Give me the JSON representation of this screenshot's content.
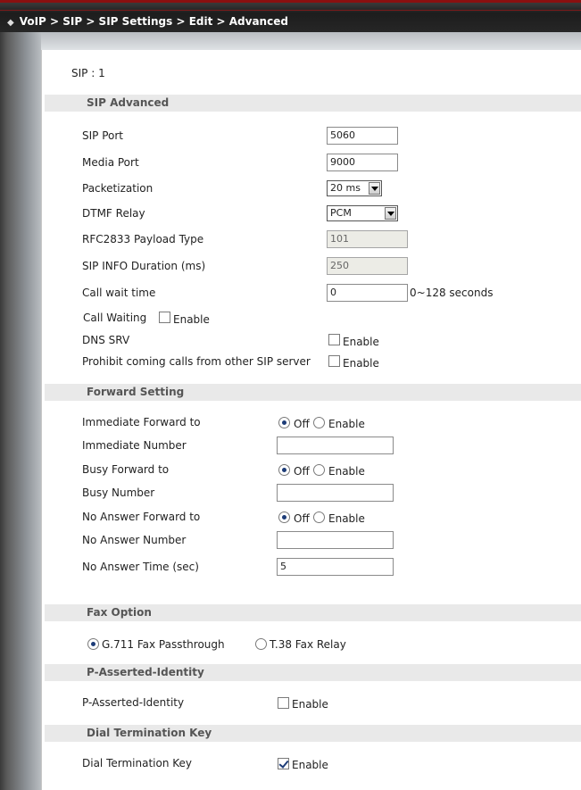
{
  "breadcrumb": "VoIP > SIP > SIP Settings > Edit > Advanced",
  "sip_id": "SIP : 1",
  "sections": {
    "sip_advanced": "SIP Advanced",
    "forward": "Forward Setting",
    "fax": "Fax Option",
    "pai": "P-Asserted-Identity",
    "dtk": "Dial Termination Key"
  },
  "sip_advanced": {
    "sip_port": {
      "label": "SIP Port",
      "value": "5060"
    },
    "media_port": {
      "label": "Media Port",
      "value": "9000"
    },
    "packetization": {
      "label": "Packetization",
      "value": "20 ms"
    },
    "dtmf_relay": {
      "label": "DTMF Relay",
      "value": "PCM"
    },
    "rfc2833": {
      "label": "RFC2833 Payload Type",
      "value": "101"
    },
    "sip_info": {
      "label": "SIP INFO Duration (ms)",
      "value": "250"
    },
    "call_wait_time": {
      "label": "Call wait time",
      "value": "0",
      "suffix": "0~128 seconds"
    },
    "call_waiting": {
      "label": "Call Waiting",
      "option": "Enable",
      "checked": false
    },
    "dns_srv": {
      "label": "DNS SRV",
      "option": "Enable",
      "checked": false
    },
    "prohibit": {
      "label": "Prohibit coming calls from other SIP server",
      "option": "Enable",
      "checked": false
    }
  },
  "forward": {
    "immediate": {
      "label": "Immediate Forward to",
      "off": "Off",
      "enable": "Enable",
      "selected": "Off"
    },
    "immediate_number": {
      "label": "Immediate Number",
      "value": ""
    },
    "busy": {
      "label": "Busy Forward to",
      "off": "Off",
      "enable": "Enable",
      "selected": "Off"
    },
    "busy_number": {
      "label": "Busy Number",
      "value": ""
    },
    "no_answer": {
      "label": "No Answer Forward to",
      "off": "Off",
      "enable": "Enable",
      "selected": "Off"
    },
    "no_answer_number": {
      "label": "No Answer Number",
      "value": ""
    },
    "no_answer_time": {
      "label": "No Answer Time (sec)",
      "value": "5"
    }
  },
  "fax": {
    "g711": "G.711 Fax Passthrough",
    "t38": "T.38 Fax Relay",
    "selected": "G.711 Fax Passthrough"
  },
  "pai": {
    "label": "P-Asserted-Identity",
    "option": "Enable",
    "checked": false
  },
  "dtk": {
    "label": "Dial Termination Key",
    "option": "Enable",
    "checked": true
  },
  "colors": {
    "accent": "#1d3c78",
    "section_bg": "#e9e9e9",
    "topbar_red": "#8a1010"
  }
}
